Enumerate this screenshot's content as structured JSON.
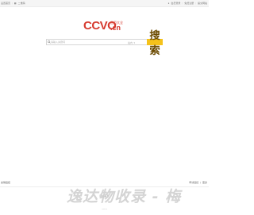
{
  "topbar": {
    "left": {
      "favorite": "设置首页",
      "qrcode": "二维码"
    },
    "right": {
      "login": "会员登录",
      "register": "免费注册",
      "submit": "提交网站"
    }
  },
  "logo": {
    "wordmark": "CCVO",
    "suffix": ".cn",
    "tagline": "首页大全"
  },
  "search": {
    "placeholder": "请输入关键词",
    "scope": "站内",
    "button": "搜索"
  },
  "links": {
    "title": "友情链接",
    "apply": "申请链接",
    "more": "更多"
  },
  "footer": {
    "line": "网站首页",
    "sub": "ccvo.cn"
  },
  "watermark": "逸达物收录 - 梅",
  "colors": {
    "accent": "#d63a2f",
    "button": "#f5c21b"
  }
}
